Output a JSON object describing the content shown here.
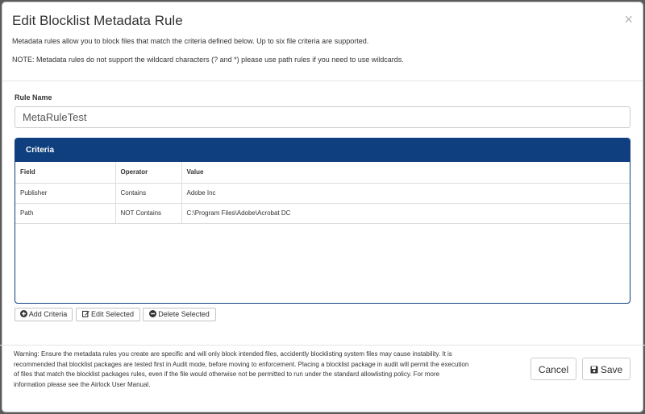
{
  "dialog": {
    "title": "Edit Blocklist Metadata Rule",
    "close_glyph": "×",
    "description": "Metadata rules allow you to block files that match the criteria defined below. Up to six file criteria are supported.",
    "note": "NOTE: Metadata rules do not support the wildcard characters (? and *) please use path rules if you need to use wildcards."
  },
  "rule_name": {
    "label": "Rule Name",
    "value": "MetaRuleTest"
  },
  "criteria": {
    "title": "Criteria",
    "columns": [
      "Field",
      "Operator",
      "Value"
    ],
    "rows": [
      {
        "field": "Publisher",
        "operator": "Contains",
        "value": "Adobe Inc"
      },
      {
        "field": "Path",
        "operator": "NOT Contains",
        "value": "C:\\Program Files\\Adobe\\Acrobat DC"
      }
    ],
    "buttons": {
      "add": "Add Criteria",
      "edit": "Edit Selected",
      "delete": "Delete Selected"
    }
  },
  "footer": {
    "warning": "Warning: Ensure the metadata rules you create are specific and will only block intended files, accidently blocklisting system files may cause instability. It is recommended that blocklist packages are tested first in Audit mode, before moving to enforcement. Placing a blocklist package in audit will permit the execution of files that match the blocklist packages rules, even if the file would otherwise not be permitted to run under the standard allowlisting policy. For more information please see the Airlock User Manual.",
    "cancel_label": "Cancel",
    "save_label": "Save"
  },
  "colors": {
    "criteria_header": "#0f3f7e",
    "backdrop": "#5a5a5a"
  },
  "icons": [
    "close-icon",
    "plus-circle-icon",
    "edit-icon",
    "minus-circle-icon",
    "floppy-disk-icon"
  ]
}
